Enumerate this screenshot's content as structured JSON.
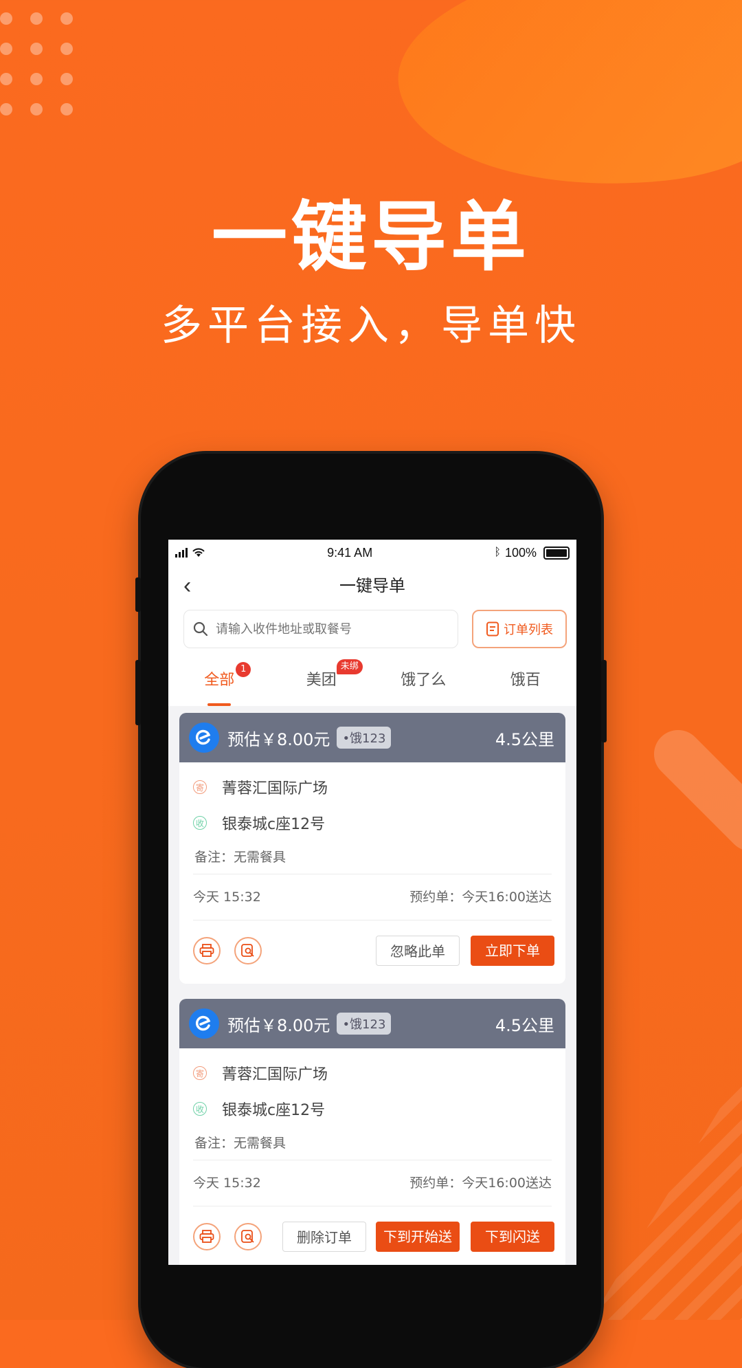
{
  "promo": {
    "headline": "一键导单",
    "subline": "多平台接入，导单快"
  },
  "status_bar": {
    "time": "9:41 AM",
    "battery": "100%"
  },
  "nav": {
    "title": "一键导单"
  },
  "search": {
    "placeholder": "请输入收件地址或取餐号",
    "order_list_label": "订单列表"
  },
  "tabs": [
    {
      "label": "全部",
      "badge": "1",
      "active": true
    },
    {
      "label": "美团",
      "badge": "未绑",
      "active": false
    },
    {
      "label": "饿了么",
      "badge": "",
      "active": false
    },
    {
      "label": "饿百",
      "badge": "",
      "active": false
    }
  ],
  "orders": [
    {
      "estimate": "预估￥8.00元",
      "tag": "•饿123",
      "distance": "4.5公里",
      "sender_icon": "寄",
      "sender_address": "菁蓉汇国际广场",
      "receiver_icon": "收",
      "receiver_address": "银泰城c座12号",
      "note": "备注：无需餐具",
      "time": "今天  15:32",
      "schedule": "预约单：今天16:00送达",
      "buttons": [
        "忽略此单",
        "立即下单"
      ]
    },
    {
      "estimate": "预估￥8.00元",
      "tag": "•饿123",
      "distance": "4.5公里",
      "sender_icon": "寄",
      "sender_address": "菁蓉汇国际广场",
      "receiver_icon": "收",
      "receiver_address": "银泰城c座12号",
      "note": "备注：无需餐具",
      "time": "今天  15:32",
      "schedule": "预约单：今天16:00送达",
      "buttons": [
        "删除订单",
        "下到开始送",
        "下到闪送"
      ]
    }
  ],
  "colors": {
    "background": "#f86a1e",
    "accent": "#ea4d14",
    "card_header": "#6c7284"
  }
}
